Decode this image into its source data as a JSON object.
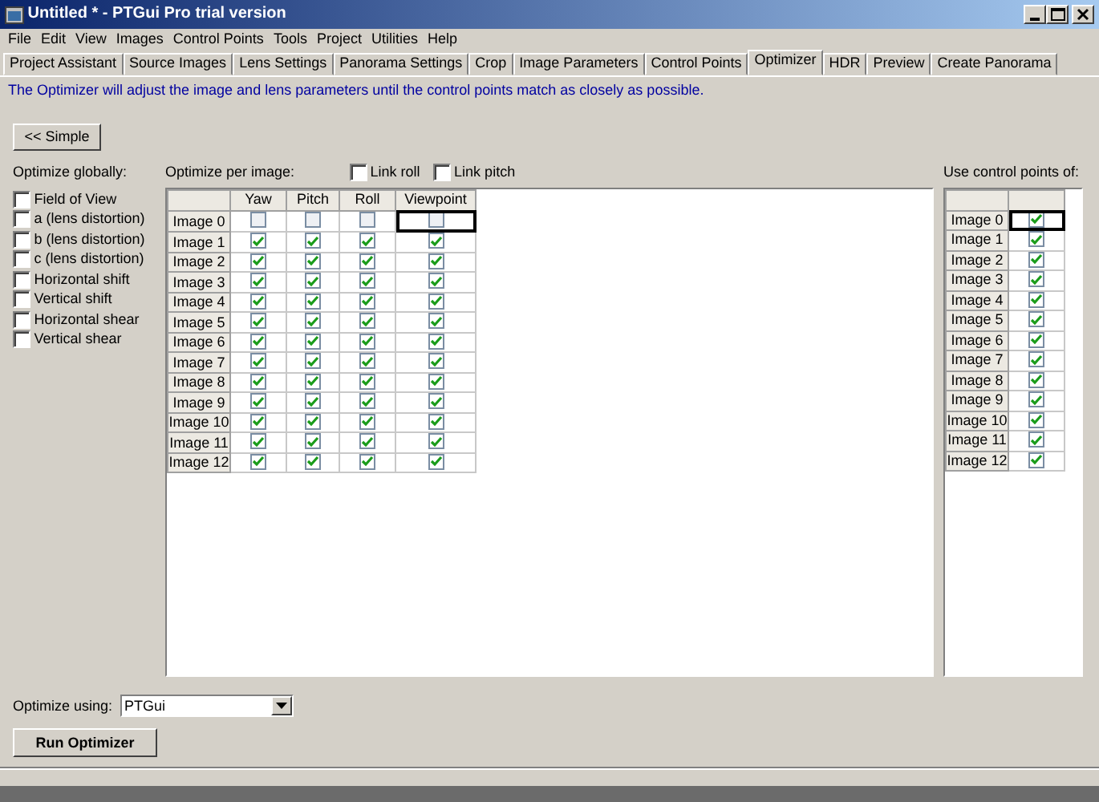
{
  "window": {
    "title": "Untitled * - PTGui Pro trial version"
  },
  "menu": [
    "File",
    "Edit",
    "View",
    "Images",
    "Control Points",
    "Tools",
    "Project",
    "Utilities",
    "Help"
  ],
  "tabs": [
    {
      "label": "Project Assistant",
      "selected": false
    },
    {
      "label": "Source Images",
      "selected": false
    },
    {
      "label": "Lens Settings",
      "selected": false
    },
    {
      "label": "Panorama Settings",
      "selected": false
    },
    {
      "label": "Crop",
      "selected": false
    },
    {
      "label": "Image Parameters",
      "selected": false
    },
    {
      "label": "Control Points",
      "selected": false
    },
    {
      "label": "Optimizer",
      "selected": true
    },
    {
      "label": "HDR",
      "selected": false
    },
    {
      "label": "Preview",
      "selected": false
    },
    {
      "label": "Create Panorama",
      "selected": false
    }
  ],
  "info": "The Optimizer will adjust the image and lens parameters until the control points match as closely as possible.",
  "simple_button": "<< Simple",
  "global": {
    "label": "Optimize globally:",
    "options": [
      {
        "label": "Field of View",
        "checked": false
      },
      {
        "label": "a (lens distortion)",
        "checked": false
      },
      {
        "label": "b (lens distortion)",
        "checked": false
      },
      {
        "label": "c (lens distortion)",
        "checked": false
      },
      {
        "label": "Horizontal shift",
        "checked": false
      },
      {
        "label": "Vertical shift",
        "checked": false
      },
      {
        "label": "Horizontal shear",
        "checked": false
      },
      {
        "label": "Vertical shear",
        "checked": false
      }
    ]
  },
  "per_image": {
    "label": "Optimize per image:",
    "link_roll": {
      "label": "Link roll",
      "checked": false
    },
    "link_pitch": {
      "label": "Link pitch",
      "checked": false
    },
    "columns": [
      "Yaw",
      "Pitch",
      "Roll",
      "Viewpoint"
    ],
    "rows": [
      {
        "name": "Image 0",
        "yaw": false,
        "pitch": false,
        "roll": false,
        "viewpoint": false,
        "focused": true
      },
      {
        "name": "Image 1",
        "yaw": true,
        "pitch": true,
        "roll": true,
        "viewpoint": true,
        "focused": false
      },
      {
        "name": "Image 2",
        "yaw": true,
        "pitch": true,
        "roll": true,
        "viewpoint": true,
        "focused": false
      },
      {
        "name": "Image 3",
        "yaw": true,
        "pitch": true,
        "roll": true,
        "viewpoint": true,
        "focused": false
      },
      {
        "name": "Image 4",
        "yaw": true,
        "pitch": true,
        "roll": true,
        "viewpoint": true,
        "focused": false
      },
      {
        "name": "Image 5",
        "yaw": true,
        "pitch": true,
        "roll": true,
        "viewpoint": true,
        "focused": false
      },
      {
        "name": "Image 6",
        "yaw": true,
        "pitch": true,
        "roll": true,
        "viewpoint": true,
        "focused": false
      },
      {
        "name": "Image 7",
        "yaw": true,
        "pitch": true,
        "roll": true,
        "viewpoint": true,
        "focused": false
      },
      {
        "name": "Image 8",
        "yaw": true,
        "pitch": true,
        "roll": true,
        "viewpoint": true,
        "focused": false
      },
      {
        "name": "Image 9",
        "yaw": true,
        "pitch": true,
        "roll": true,
        "viewpoint": true,
        "focused": false
      },
      {
        "name": "Image 10",
        "yaw": true,
        "pitch": true,
        "roll": true,
        "viewpoint": true,
        "focused": false
      },
      {
        "name": "Image 11",
        "yaw": true,
        "pitch": true,
        "roll": true,
        "viewpoint": true,
        "focused": false
      },
      {
        "name": "Image 12",
        "yaw": true,
        "pitch": true,
        "roll": true,
        "viewpoint": true,
        "focused": false
      }
    ]
  },
  "control_points": {
    "label": "Use control points of:",
    "rows": [
      {
        "name": "Image 0",
        "checked": true,
        "focused": true
      },
      {
        "name": "Image 1",
        "checked": true,
        "focused": false
      },
      {
        "name": "Image 2",
        "checked": true,
        "focused": false
      },
      {
        "name": "Image 3",
        "checked": true,
        "focused": false
      },
      {
        "name": "Image 4",
        "checked": true,
        "focused": false
      },
      {
        "name": "Image 5",
        "checked": true,
        "focused": false
      },
      {
        "name": "Image 6",
        "checked": true,
        "focused": false
      },
      {
        "name": "Image 7",
        "checked": true,
        "focused": false
      },
      {
        "name": "Image 8",
        "checked": true,
        "focused": false
      },
      {
        "name": "Image 9",
        "checked": true,
        "focused": false
      },
      {
        "name": "Image 10",
        "checked": true,
        "focused": false
      },
      {
        "name": "Image 11",
        "checked": true,
        "focused": false
      },
      {
        "name": "Image 12",
        "checked": true,
        "focused": false
      }
    ]
  },
  "optimize_using": {
    "label": "Optimize using:",
    "value": "PTGui"
  },
  "run_button": "Run Optimizer"
}
